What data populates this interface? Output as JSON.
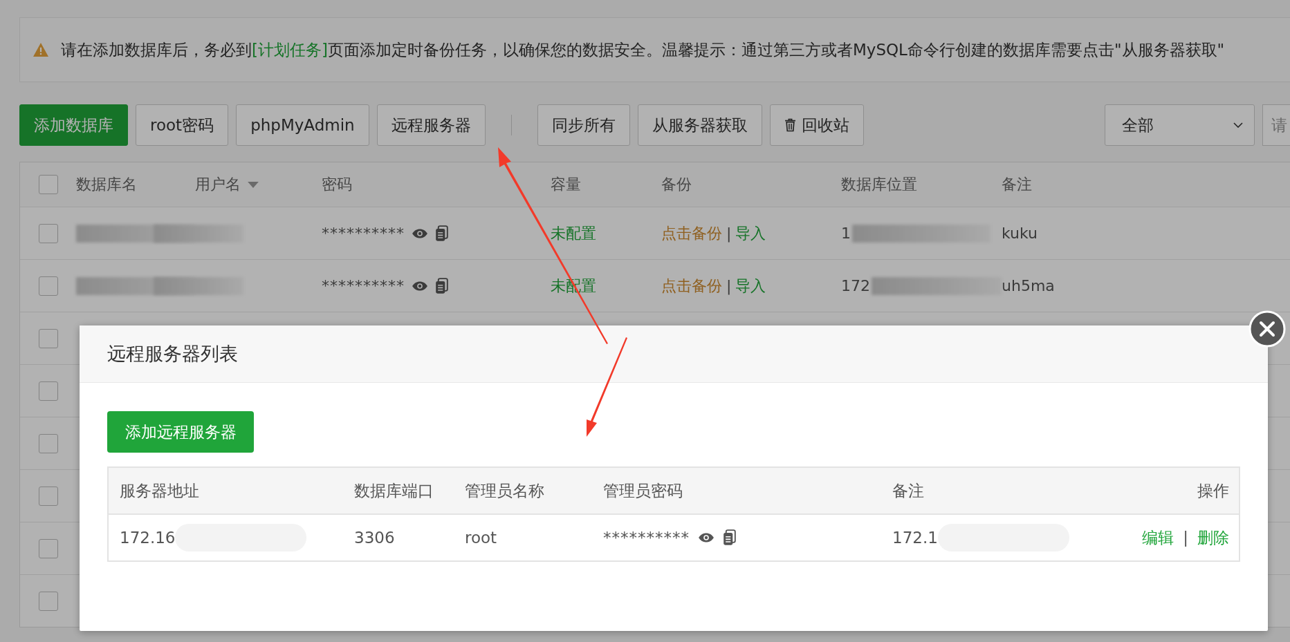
{
  "notice": {
    "before": "请在添加数据库后，务必到",
    "link": "[计划任务]",
    "after": "页面添加定时备份任务，以确保您的数据安全。温馨提示：通过第三方或者MySQL命令行创建的数据库需要点击\"从服务器获取\""
  },
  "toolbar": {
    "groups": [
      [
        {
          "label": "添加数据库",
          "kind": "primary"
        },
        {
          "label": "root密码",
          "kind": "default"
        },
        {
          "label": "phpMyAdmin",
          "kind": "default"
        },
        {
          "label": "远程服务器",
          "kind": "default"
        }
      ],
      [
        {
          "label": "同步所有",
          "kind": "default"
        },
        {
          "label": "从服务器获取",
          "kind": "default"
        },
        {
          "label": "回收站",
          "kind": "trash"
        }
      ]
    ],
    "filter": {
      "value": "全部"
    },
    "search": {
      "placeholder": "请"
    }
  },
  "table": {
    "all_checked": false,
    "columns": [
      {
        "label": "数据库名",
        "sorted": false
      },
      {
        "label": "用户名",
        "sorted": true
      },
      {
        "label": "密码",
        "sorted": false
      },
      {
        "label": "容量",
        "sorted": false
      },
      {
        "label": "备份",
        "sorted": false
      },
      {
        "label": "数据库位置",
        "sorted": false
      },
      {
        "label": "备注",
        "sorted": false
      }
    ],
    "rows": [
      {
        "checked": false,
        "blurred": true,
        "password": "**********",
        "capacity": "未配置",
        "backup": "点击备份",
        "separator": "|",
        "import": "导入",
        "location": "1",
        "note": "kuku"
      },
      {
        "checked": false,
        "blurred": true,
        "password": "**********",
        "capacity": "未配置",
        "backup": "点击备份",
        "separator": "|",
        "import": "导入",
        "location": "172",
        "note": "uh5ma"
      },
      {
        "checked": false
      },
      {
        "checked": false
      },
      {
        "checked": false
      },
      {
        "checked": false
      },
      {
        "checked": false
      },
      {
        "checked": false
      }
    ]
  },
  "modal": {
    "title": "远程服务器列表",
    "add_button": "添加远程服务器",
    "columns": [
      "服务器地址",
      "数据库端口",
      "管理员名称",
      "管理员密码",
      "备注",
      "操作"
    ],
    "rows": [
      {
        "blurred": true,
        "address": "172.16",
        "port": "3306",
        "admin": "root",
        "password": "**********",
        "note": "172.1",
        "edit": "编辑",
        "separator": "|",
        "delete": "删除"
      }
    ]
  }
}
